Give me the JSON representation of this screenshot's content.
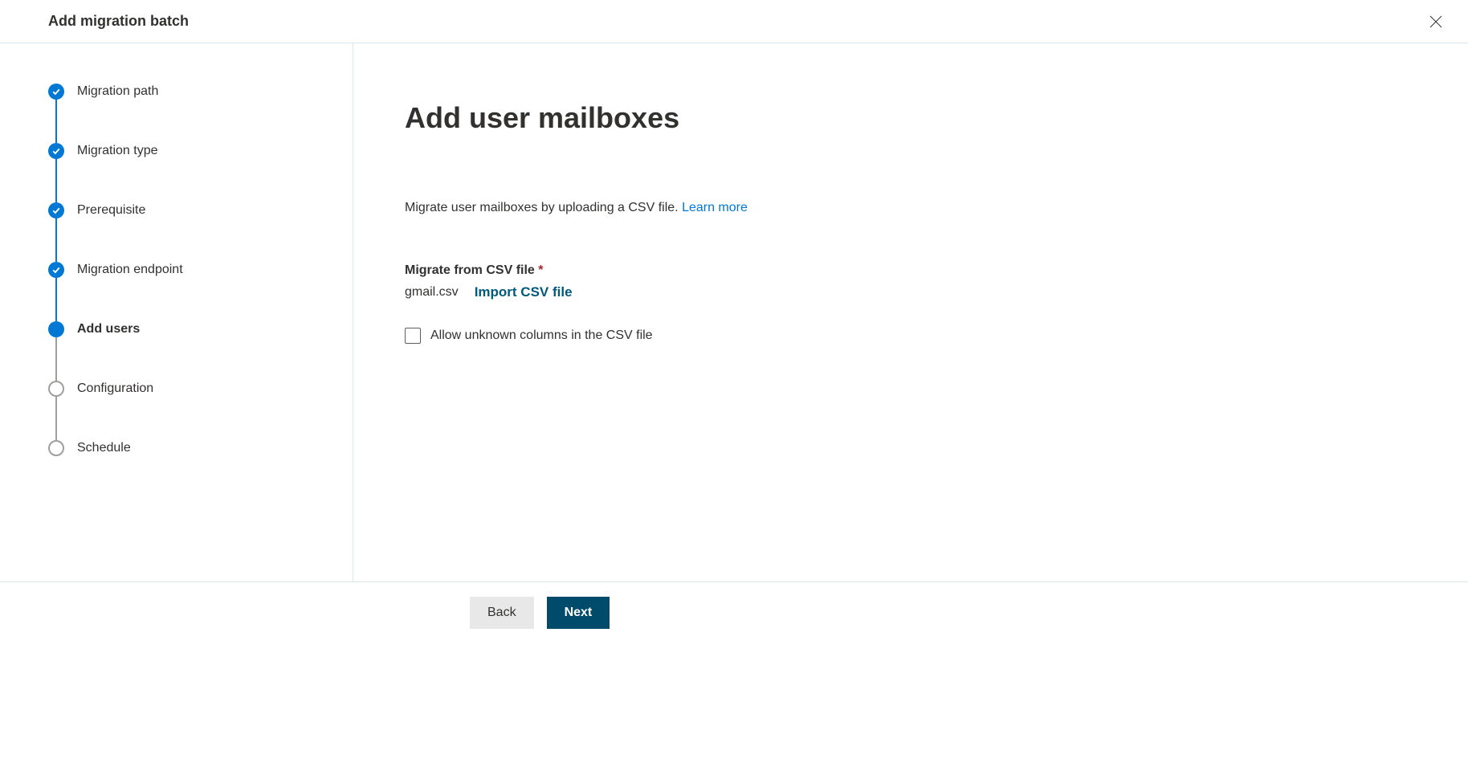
{
  "header": {
    "title": "Add migration batch"
  },
  "steps": [
    {
      "label": "Migration path",
      "state": "completed"
    },
    {
      "label": "Migration type",
      "state": "completed"
    },
    {
      "label": "Prerequisite",
      "state": "completed"
    },
    {
      "label": "Migration endpoint",
      "state": "completed"
    },
    {
      "label": "Add users",
      "state": "current"
    },
    {
      "label": "Configuration",
      "state": "upcoming"
    },
    {
      "label": "Schedule",
      "state": "upcoming"
    }
  ],
  "main": {
    "title": "Add user mailboxes",
    "description_text": "Migrate user mailboxes by uploading a CSV file. ",
    "learn_more": "Learn more",
    "form_label": "Migrate from CSV file",
    "file_name": "gmail.csv",
    "import_link": "Import CSV file",
    "checkbox_label": "Allow unknown columns in the CSV file"
  },
  "footer": {
    "back": "Back",
    "next": "Next"
  }
}
